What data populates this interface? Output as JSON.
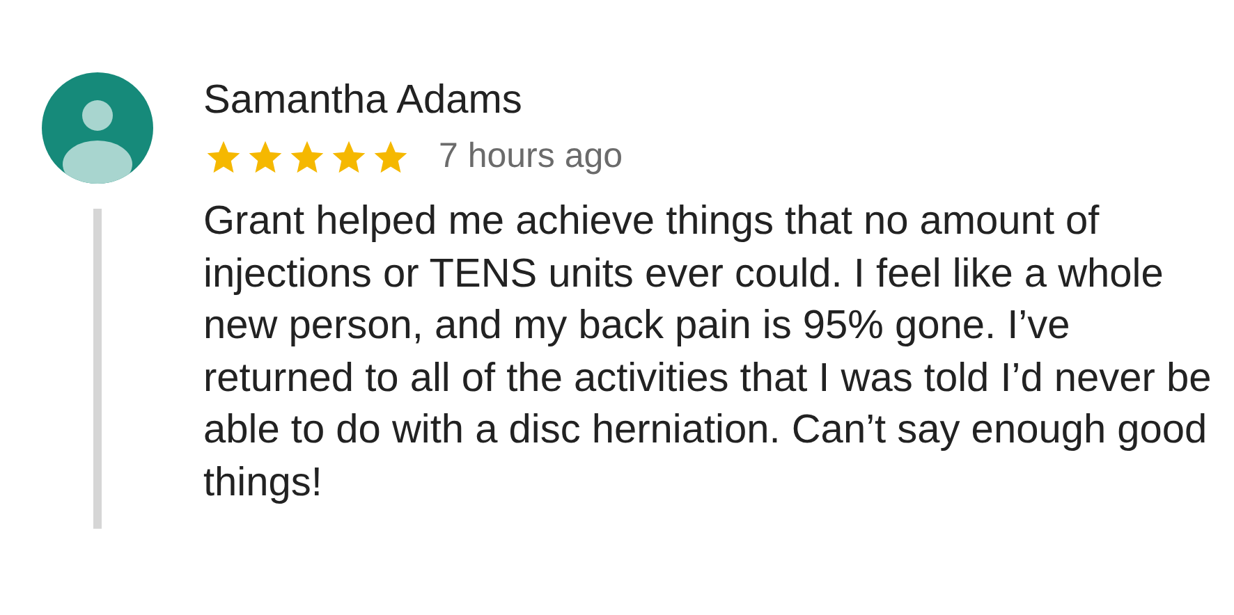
{
  "review": {
    "author": "Samantha Adams",
    "stars": 5,
    "time": "7 hours ago",
    "text": "Grant helped me achieve things that no amount of injections or TENS units ever could. I feel like a whole new person, and my back pain is 95% gone. I’ve returned to all of the activities that I was told I’d never be able to do with a disc herniation. Can’t say enough good things!"
  }
}
